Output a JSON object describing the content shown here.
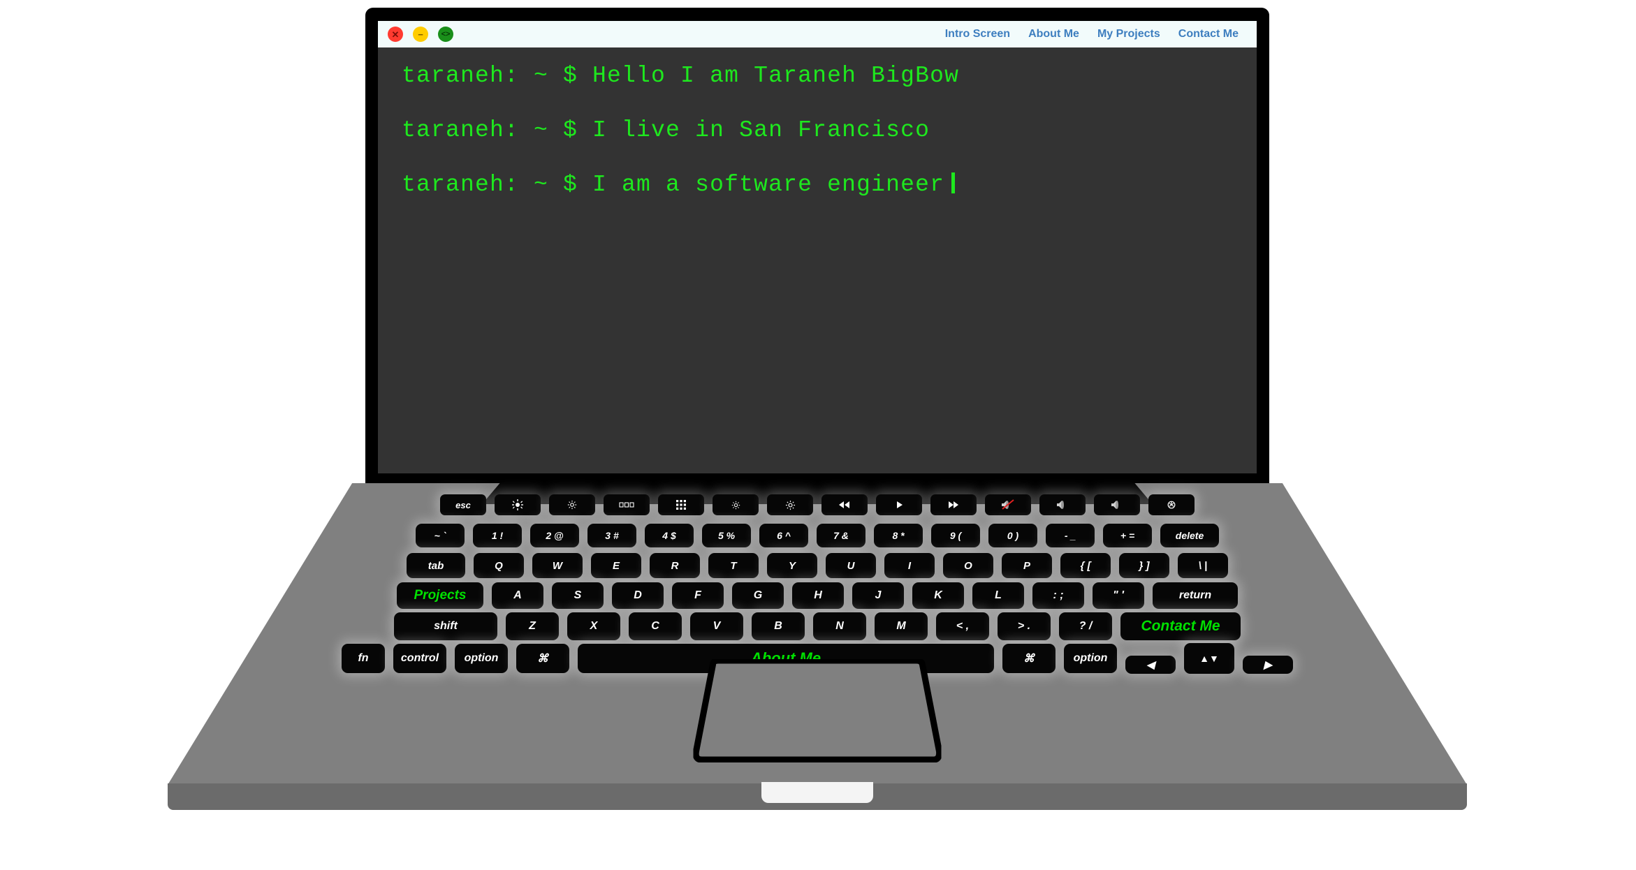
{
  "window": {
    "traffic_lights": [
      {
        "name": "close",
        "glyph": "✕",
        "color": "#ff3b30"
      },
      {
        "name": "minimize",
        "glyph": "−",
        "color": "#ffcc00"
      },
      {
        "name": "maximize",
        "glyph": "<>",
        "color": "#1a8f1a"
      }
    ],
    "nav": [
      {
        "label": "Intro Screen"
      },
      {
        "label": "About Me"
      },
      {
        "label": "My Projects"
      },
      {
        "label": "Contact Me"
      }
    ],
    "nav_color": "#3d7ebf",
    "titlebar_bg": "#f2fbfb"
  },
  "terminal": {
    "bg": "#333333",
    "text_color": "#1ee81e",
    "lines": [
      "taraneh: ~ $ Hello I am Taraneh BigBow",
      "taraneh: ~ $ I live in San Francisco",
      "taraneh: ~ $ I am a software engineer"
    ],
    "cursor_visible": true
  },
  "keyboard": {
    "accent_color": "#00e000",
    "rows": {
      "function": [
        {
          "label": "esc",
          "icon": null
        },
        {
          "label": "",
          "icon": "brightness-up-icon"
        },
        {
          "label": "",
          "icon": "keyboard-brightness-icon"
        },
        {
          "label": "",
          "icon": "mission-control-icon"
        },
        {
          "label": "",
          "icon": "launchpad-icon"
        },
        {
          "label": "",
          "icon": "brightness-down-icon"
        },
        {
          "label": "",
          "icon": "brightness-up-2-icon"
        },
        {
          "label": "",
          "icon": "rewind-icon"
        },
        {
          "label": "",
          "icon": "play-pause-icon"
        },
        {
          "label": "",
          "icon": "fast-forward-icon"
        },
        {
          "label": "",
          "icon": "mute-icon"
        },
        {
          "label": "",
          "icon": "volume-down-icon"
        },
        {
          "label": "",
          "icon": "volume-up-icon"
        },
        {
          "label": "",
          "icon": "power-icon"
        }
      ],
      "number": [
        "~ `",
        "1 !",
        "2 @",
        "3 #",
        "4 $",
        "5 %",
        "6 ^",
        "7 &",
        "8 *",
        "9 (",
        "0 )",
        "- _",
        "+ =",
        "delete"
      ],
      "qwerty": [
        "tab",
        "Q",
        "W",
        "E",
        "R",
        "T",
        "Y",
        "U",
        "I",
        "O",
        "P",
        "{ [",
        "} ]",
        "\\ |"
      ],
      "home": [
        "Projects",
        "A",
        "S",
        "D",
        "F",
        "G",
        "H",
        "J",
        "K",
        "L",
        ": ;",
        "\" '",
        "return"
      ],
      "shift": [
        "shift",
        "Z",
        "X",
        "C",
        "V",
        "B",
        "N",
        "M",
        "< ,",
        "> .",
        "? /",
        "Contact Me"
      ],
      "modifier": [
        "fn",
        "control",
        "option",
        "⌘",
        "About Me",
        "⌘",
        "option"
      ]
    },
    "accent_keys": [
      "Projects",
      "Contact Me",
      "About Me"
    ],
    "arrows": {
      "left": "◀",
      "up": "▲",
      "down": "▼",
      "right": "▶"
    }
  },
  "chassis": {
    "base_color": "#808080",
    "front_color": "#6b6b6b",
    "bezel_color": "#000000",
    "notch_color": "#f4f4f4"
  }
}
